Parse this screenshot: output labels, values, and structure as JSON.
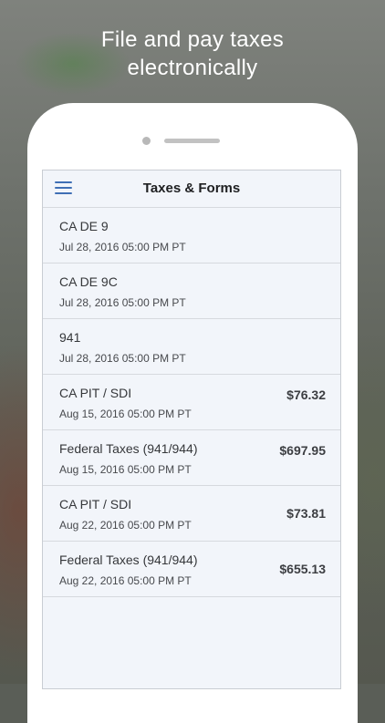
{
  "headline": "File and pay taxes\nelectronically",
  "nav": {
    "title": "Taxes & Forms"
  },
  "items": [
    {
      "name": "CA DE 9",
      "date": "Jul 28, 2016 05:00 PM PT",
      "amount": ""
    },
    {
      "name": "CA DE 9C",
      "date": "Jul 28, 2016 05:00 PM PT",
      "amount": ""
    },
    {
      "name": "941",
      "date": "Jul 28, 2016 05:00 PM PT",
      "amount": ""
    },
    {
      "name": "CA PIT / SDI",
      "date": "Aug 15, 2016 05:00 PM PT",
      "amount": "$76.32"
    },
    {
      "name": "Federal Taxes (941/944)",
      "date": "Aug 15, 2016 05:00 PM PT",
      "amount": "$697.95"
    },
    {
      "name": "CA PIT / SDI",
      "date": "Aug 22, 2016 05:00 PM PT",
      "amount": "$73.81"
    },
    {
      "name": "Federal Taxes (941/944)",
      "date": "Aug 22, 2016 05:00 PM PT",
      "amount": "$655.13"
    }
  ],
  "colors": {
    "accent": "#3f6fb5",
    "screen_background": "#f2f5fa"
  },
  "icons": {
    "menu": "hamburger-menu-icon"
  }
}
